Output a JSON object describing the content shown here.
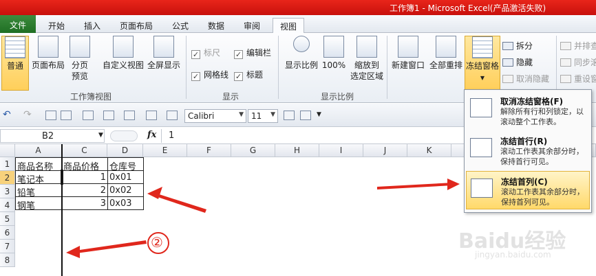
{
  "window": {
    "title": "工作簿1 - Microsoft Excel(产品激活失败)"
  },
  "tabs": [
    {
      "label": "文件"
    },
    {
      "label": "开始"
    },
    {
      "label": "插入"
    },
    {
      "label": "页面布局"
    },
    {
      "label": "公式"
    },
    {
      "label": "数据"
    },
    {
      "label": "审阅"
    },
    {
      "label": "视图"
    }
  ],
  "ribbon": {
    "workbook_views": {
      "normal": "普通",
      "page_layout": "页面布局",
      "page_break_1": "分页",
      "page_break_2": "预览",
      "custom_view": "自定义视图",
      "full_screen": "全屏显示",
      "group_label": "工作簿视图"
    },
    "show": {
      "ruler": "标尺",
      "formula_bar": "编辑栏",
      "gridlines": "网格线",
      "headings": "标题",
      "group_label": "显示"
    },
    "zoom": {
      "zoom": "显示比例",
      "hundred": "100%",
      "zoom_sel_1": "缩放到",
      "zoom_sel_2": "选定区域",
      "group_label": "显示比例"
    },
    "window": {
      "new_window": "新建窗口",
      "arrange_all": "全部重排",
      "freeze_panes": "冻结窗格",
      "split": "拆分",
      "hide": "隐藏",
      "unhide": "取消隐藏",
      "side_by_side": "并排查",
      "sync_scroll": "同步滚",
      "reset_pos": "重设窗"
    }
  },
  "toolbar": {
    "font": "Calibri",
    "size": "11"
  },
  "formula_bar": {
    "name_box": "B2",
    "fx": "fx",
    "value": "1"
  },
  "grid": {
    "columns": [
      "A",
      "C",
      "D",
      "E",
      "F",
      "G",
      "H",
      "I",
      "J",
      "K"
    ],
    "rows": [
      "1",
      "2",
      "3",
      "4",
      "5",
      "6",
      "7",
      "8"
    ],
    "header": [
      "商品名称",
      "商品价格",
      "仓库号"
    ],
    "data": [
      [
        "笔记本",
        "1",
        "0x01"
      ],
      [
        "铅笔",
        "2",
        "0x02"
      ],
      [
        "钢笔",
        "3",
        "0x03"
      ]
    ]
  },
  "freeze_menu": {
    "items": [
      {
        "title": "取消冻结窗格(F)",
        "desc": "解除所有行和列锁定，以滚动整个工作表。"
      },
      {
        "title": "冻结首行(R)",
        "desc": "滚动工作表其余部分时，保持首行可见。"
      },
      {
        "title": "冻结首列(C)",
        "desc": "滚动工作表其余部分时，保持首列可见。"
      }
    ]
  },
  "annotation": {
    "circle_number": "②"
  },
  "watermark": {
    "logo": "Baidu经验",
    "url": "jingyan.baidu.com"
  },
  "colors": {
    "title_red": "#d4150f",
    "file_green": "#2e7d32",
    "highlight": "#ffd96a",
    "arrow_red": "#e0271c"
  }
}
